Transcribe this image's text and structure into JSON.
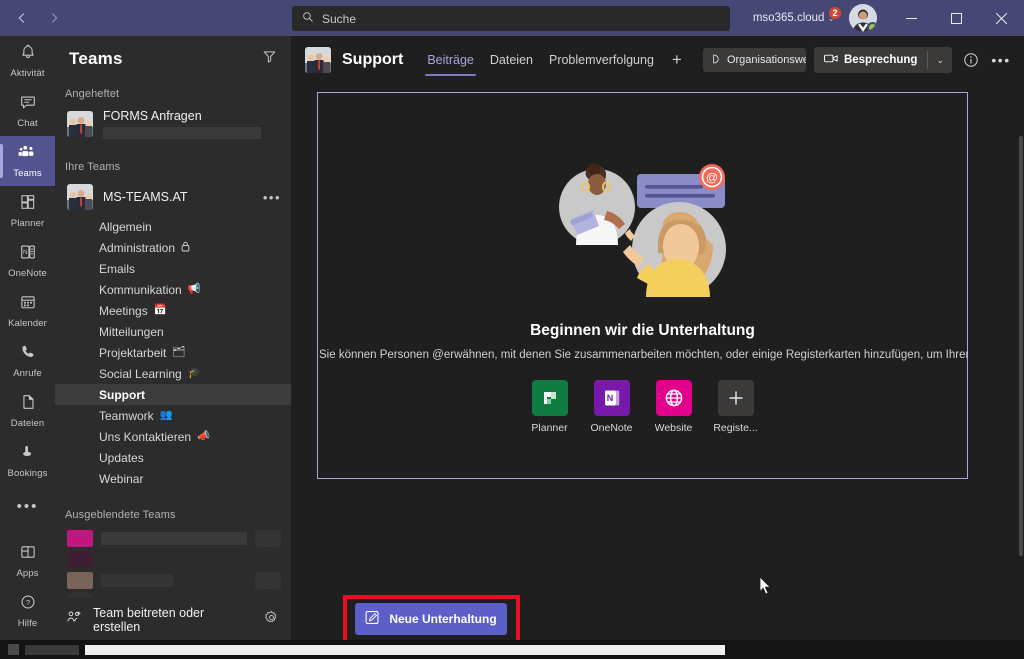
{
  "window": {
    "back_icon": "chevron-left-icon",
    "forward_icon": "chevron-right-icon",
    "minimize_label": "─",
    "maximize_label": "☐",
    "close_label": "✕"
  },
  "search": {
    "placeholder": "Suche",
    "value": "",
    "icon": "search-icon"
  },
  "account": {
    "tenant": "mso365.cloud",
    "chevron": "⌄",
    "notification_count": "2",
    "presence": "available",
    "presence_color": "#92c353"
  },
  "rail": {
    "items": [
      {
        "label": "Aktivität",
        "icon": "bell-icon",
        "active": false
      },
      {
        "label": "Chat",
        "icon": "chat-icon",
        "active": false
      },
      {
        "label": "Teams",
        "icon": "teams-icon",
        "active": true
      },
      {
        "label": "Planner",
        "icon": "planner-icon",
        "active": false
      },
      {
        "label": "OneNote",
        "icon": "onenote-icon",
        "active": false
      },
      {
        "label": "Kalender",
        "icon": "calendar-icon",
        "active": false
      },
      {
        "label": "Anrufe",
        "icon": "phone-icon",
        "active": false
      },
      {
        "label": "Dateien",
        "icon": "files-icon",
        "active": false
      },
      {
        "label": "Bookings",
        "icon": "bookings-icon",
        "active": false
      }
    ],
    "more_label": "•••",
    "bottom": [
      {
        "label": "Apps",
        "icon": "apps-icon"
      },
      {
        "label": "Hilfe",
        "icon": "help-icon"
      }
    ]
  },
  "teams_panel": {
    "title": "Teams",
    "filter_icon": "filter-icon",
    "pinned_section": "Angeheftet",
    "pinned": [
      {
        "name": "FORMS Anfragen",
        "avatar": "team-photo-avatar",
        "redacted": true
      }
    ],
    "your_teams_section": "Ihre Teams",
    "team": {
      "name": "MS-TEAMS.AT",
      "avatar": "team-photo-avatar",
      "more_icon": "more-options-icon",
      "more_label": "•••"
    },
    "channels": [
      {
        "name": "Allgemein",
        "emoji": "",
        "selected": false,
        "lock": false
      },
      {
        "name": "Administration",
        "emoji": "🔒",
        "selected": false,
        "lock": true
      },
      {
        "name": "Emails",
        "emoji": "",
        "selected": false,
        "lock": false
      },
      {
        "name": "Kommunikation",
        "emoji": "📢",
        "selected": false,
        "lock": false
      },
      {
        "name": "Meetings",
        "emoji": "📅",
        "selected": false,
        "lock": false
      },
      {
        "name": "Mitteilungen",
        "emoji": "",
        "selected": false,
        "lock": false
      },
      {
        "name": "Projektarbeit",
        "emoji": "🗂",
        "selected": false,
        "lock": false
      },
      {
        "name": "Social Learning",
        "emoji": "🎓",
        "selected": false,
        "lock": false
      },
      {
        "name": "Support",
        "emoji": "",
        "selected": true,
        "lock": false
      },
      {
        "name": "Teamwork",
        "emoji": "👥",
        "selected": false,
        "lock": false
      },
      {
        "name": "Uns Kontaktieren",
        "emoji": "📣",
        "selected": false,
        "lock": false
      },
      {
        "name": "Updates",
        "emoji": "",
        "selected": false,
        "lock": false
      },
      {
        "name": "Webinar",
        "emoji": "",
        "selected": false,
        "lock": false
      }
    ],
    "hidden_section": "Ausgeblendete Teams",
    "hidden_redacted": true,
    "footer": {
      "label": "Team beitreten oder erstellen",
      "icon": "add-team-icon",
      "gear_icon": "settings-gear-icon"
    }
  },
  "channel_header": {
    "avatar": "team-photo-avatar",
    "title": "Support",
    "tabs": [
      {
        "label": "Beiträge",
        "active": true
      },
      {
        "label": "Dateien",
        "active": false
      },
      {
        "label": "Problemverfolgung",
        "active": false
      }
    ],
    "add_tab_label": "+",
    "org_button": {
      "label": "Organisationswe",
      "icon": "org-chart-icon"
    },
    "meet_button": {
      "label": "Besprechung",
      "icon": "video-camera-icon",
      "chevron": "⌄"
    },
    "info_icon": "info-circle-icon",
    "more_icon": "more-options-icon",
    "more_label": "•••"
  },
  "welcome_card": {
    "illustration": "two-people-chat-mention-illustration",
    "heading": "Beginnen wir die Unterhaltung",
    "subtitle": "Sie können Personen @erwähnen, mit denen Sie zusammenarbeiten möchten, oder einige Registerkarten hinzufügen, um Ihren Bere",
    "apps": [
      {
        "label": "Planner",
        "icon": "planner-app-icon",
        "color": "#107c41"
      },
      {
        "label": "OneNote",
        "icon": "onenote-app-icon",
        "color": "#7719aa"
      },
      {
        "label": "Website",
        "icon": "globe-icon",
        "color": "#e3008c"
      },
      {
        "label": "Registe...",
        "icon": "plus-icon",
        "color": "#3b3a39"
      }
    ]
  },
  "new_conversation": {
    "label": "Neue Unterhaltung",
    "icon": "compose-pencil-icon",
    "button_color": "#5b5fc7",
    "highlight_color": "#e81123"
  },
  "theme": {
    "titlebar": "#464775",
    "sidebar": "#2d2c2c",
    "content": "#1f1f1f",
    "accent": "#a6a7dc",
    "selected_channel": "#3d3c3c"
  }
}
